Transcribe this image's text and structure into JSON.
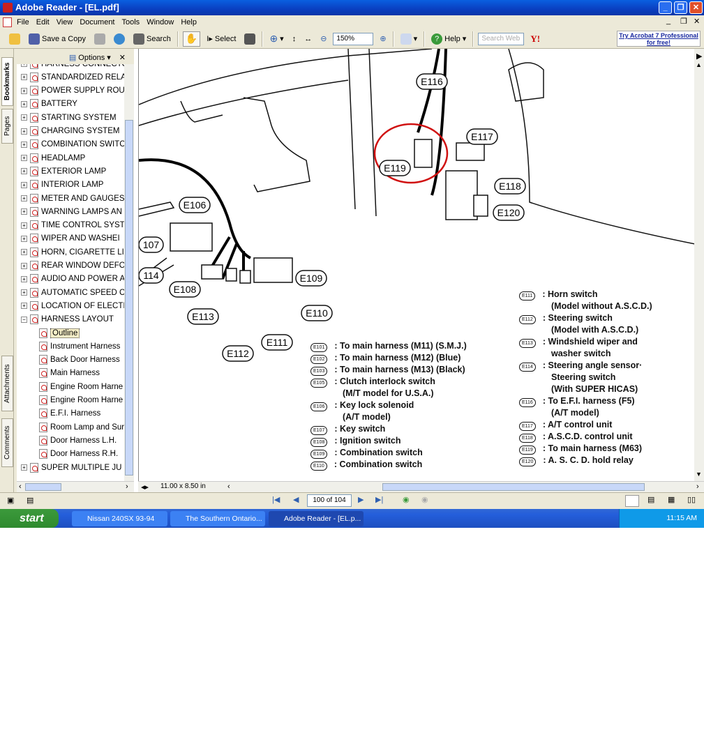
{
  "window": {
    "title": "Adobe Reader - [EL.pdf]"
  },
  "menu": [
    "File",
    "Edit",
    "View",
    "Document",
    "Tools",
    "Window",
    "Help"
  ],
  "toolbar": {
    "save_copy": "Save a Copy",
    "search": "Search",
    "select": "Select",
    "zoom": "150%",
    "help": "Help",
    "search_web_placeholder": "Search Web",
    "promo": "Try Acrobat 7 Professional for free!"
  },
  "panel": {
    "options": "Options",
    "tabs": [
      "Bookmarks",
      "Pages",
      "Attachments",
      "Comments"
    ]
  },
  "bookmarks": [
    {
      "label": "HARNESS CONNECTOR",
      "level": 0
    },
    {
      "label": "STANDARDIZED RELA",
      "level": 0
    },
    {
      "label": "POWER SUPPLY ROU",
      "level": 0
    },
    {
      "label": "BATTERY",
      "level": 0
    },
    {
      "label": "STARTING SYSTEM",
      "level": 0
    },
    {
      "label": "CHARGING SYSTEM",
      "level": 0
    },
    {
      "label": "COMBINATION SWITC",
      "level": 0
    },
    {
      "label": "HEADLAMP",
      "level": 0
    },
    {
      "label": "EXTERIOR LAMP",
      "level": 0
    },
    {
      "label": "INTERIOR LAMP",
      "level": 0
    },
    {
      "label": "METER AND GAUGES",
      "level": 0
    },
    {
      "label": "WARNING LAMPS AN",
      "level": 0
    },
    {
      "label": "TIME CONTROL SYST",
      "level": 0
    },
    {
      "label": " WIPER AND WASHEI",
      "level": 0
    },
    {
      "label": "HORN, CIGARETTE LI",
      "level": 0
    },
    {
      "label": "REAR WINDOW DEFO",
      "level": 0
    },
    {
      "label": "AUDIO AND POWER A",
      "level": 0
    },
    {
      "label": "AUTOMATIC SPEED C",
      "level": 0
    },
    {
      "label": "LOCATION OF ELECTI",
      "level": 0
    },
    {
      "label": "HARNESS LAYOUT",
      "level": 0,
      "expanded": true
    },
    {
      "label": "Outline",
      "level": 1,
      "selected": true
    },
    {
      "label": "Instrument Harness",
      "level": 1
    },
    {
      "label": "Back Door Harness",
      "level": 1
    },
    {
      "label": "Main Harness",
      "level": 1
    },
    {
      "label": "Engine Room Harne",
      "level": 1
    },
    {
      "label": "Engine Room Harne",
      "level": 1
    },
    {
      "label": "E.F.I. Harness",
      "level": 1
    },
    {
      "label": "Room Lamp and Sur",
      "level": 1
    },
    {
      "label": "Door Harness L.H.",
      "level": 1
    },
    {
      "label": "Door Harness R.H.",
      "level": 1
    },
    {
      "label": "SUPER MULTIPLE JU",
      "level": 0
    }
  ],
  "document": {
    "page_size": "11.00 x 8.50 in",
    "callouts": [
      "E116",
      "E117",
      "E119",
      "E118",
      "E120",
      "E106",
      "107",
      "114",
      "E108",
      "E109",
      "E110",
      "E113",
      "E111",
      "E112"
    ],
    "legend_left": [
      {
        "code": "E101",
        "text": "To main harness (M11) (S.M.J.)"
      },
      {
        "code": "E102",
        "text": "To main harness (M12) (Blue)"
      },
      {
        "code": "E103",
        "text": "To main harness (M13) (Black)"
      },
      {
        "code": "E105",
        "text": "Clutch interlock switch",
        "sub": "(M/T model for U.S.A.)"
      },
      {
        "code": "E106",
        "text": "Key lock solenoid",
        "sub": "(A/T model)"
      },
      {
        "code": "E107",
        "text": "Key switch"
      },
      {
        "code": "E108",
        "text": "Ignition switch"
      },
      {
        "code": "E109",
        "text": "Combination switch"
      },
      {
        "code": "E110",
        "text": "Combination switch"
      }
    ],
    "legend_right": [
      {
        "code": "E111",
        "text": "Horn switch",
        "sub": "(Model without A.S.C.D.)"
      },
      {
        "code": "E112",
        "text": "Steering switch",
        "sub": "(Model with A.S.C.D.)"
      },
      {
        "code": "E113",
        "text": "Windshield wiper and",
        "sub": "washer switch"
      },
      {
        "code": "E114",
        "text": "Steering angle sensor·",
        "sub": "Steering switch",
        "sub2": "(With SUPER HICAS)"
      },
      {
        "code": "E116",
        "text": "To E.F.I. harness (F5)",
        "sub": "(A/T model)"
      },
      {
        "code": "E117",
        "text": "A/T control unit"
      },
      {
        "code": "E118",
        "text": "A.S.C.D. control unit"
      },
      {
        "code": "E119",
        "text": "To main harness (M63)"
      },
      {
        "code": "E120",
        "text": "A. S. C. D. hold relay"
      }
    ],
    "highlight_color": "#d01010"
  },
  "status": {
    "page": "100 of 104"
  },
  "taskbar": {
    "start": "start",
    "tasks": [
      "Nissan 240SX 93-94",
      "The Southern Ontario...",
      "Adobe Reader - [EL.p..."
    ],
    "clock": "11:15 AM"
  }
}
